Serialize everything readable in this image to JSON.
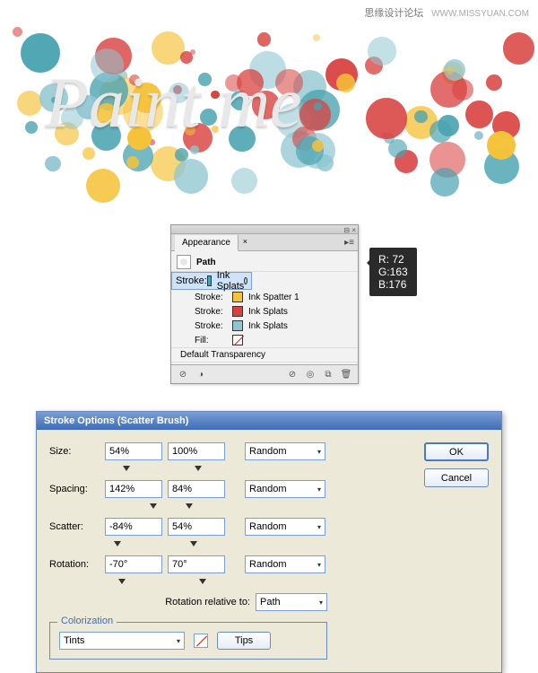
{
  "watermark": {
    "cn": "思缘设计论坛",
    "url": "WWW.MISSYUAN.COM"
  },
  "artwork_text": "Paint me",
  "appearance": {
    "tab": "Appearance",
    "path_title": "Path",
    "rows": [
      {
        "label": "Stroke:",
        "name": "Ink Splats",
        "color": "#48a3b0",
        "selected": true
      },
      {
        "label": "Stroke:",
        "name": "Ink Spatter 1",
        "color": "#f5c23a",
        "selected": false
      },
      {
        "label": "Stroke:",
        "name": "Ink Splats",
        "color": "#d84240",
        "selected": false
      },
      {
        "label": "Stroke:",
        "name": "Ink Splats",
        "color": "#8fc6d1",
        "selected": false
      }
    ],
    "fill_label": "Fill:",
    "transparency": "Default Transparency"
  },
  "rgb": {
    "r_label": "R:",
    "g_label": "G:",
    "b_label": "B:",
    "r": "72",
    "g": "163",
    "b": "176"
  },
  "dialog": {
    "title": "Stroke Options (Scatter Brush)",
    "ok": "OK",
    "cancel": "Cancel",
    "rows": {
      "size": {
        "label": "Size:",
        "a": "54%",
        "b": "100%",
        "mode": "Random"
      },
      "spacing": {
        "label": "Spacing:",
        "a": "142%",
        "b": "84%",
        "mode": "Random"
      },
      "scatter": {
        "label": "Scatter:",
        "a": "-84%",
        "b": "54%",
        "mode": "Random"
      },
      "rotation": {
        "label": "Rotation:",
        "a": "-70°",
        "b": "70°",
        "mode": "Random"
      }
    },
    "rotation_relative_label": "Rotation relative to:",
    "rotation_relative_value": "Path",
    "colorization_legend": "Colorization",
    "colorization_value": "Tints",
    "tips": "Tips"
  }
}
